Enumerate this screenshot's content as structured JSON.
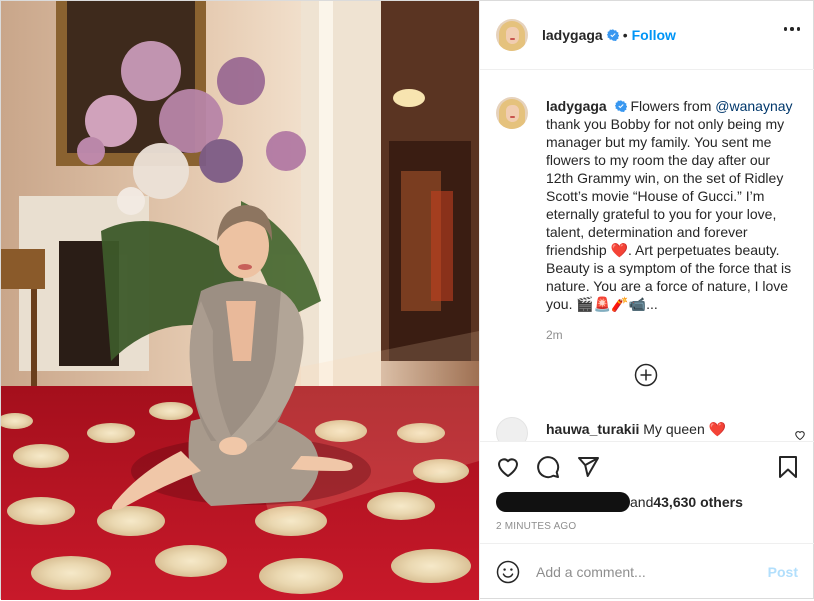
{
  "post": {
    "author": "ladygaga",
    "follow_label": "Follow",
    "separator": "•",
    "photo_alt": "Lady Gaga sitting on red carpet",
    "caption": {
      "username": "ladygaga",
      "text_before_mention": " Flowers from ",
      "mention": "@wanaynay",
      "text_part1": " thank you Bobby for not only being my manager but my family. You sent me flowers to my room the day after our 12th Grammy win, on the set of Ridley Scott’s movie “House of Gucci.” I’m eternally grateful to you for your love, talent, determination and forever friendship ",
      "heart": "❤️",
      "text_part2": ". Art perpetuates beauty. Beauty is a symptom of the force that is nature. You are a force of nature, I love you. 🎬🚨🧨📹...",
      "time": "2m"
    },
    "reply": {
      "username": "hauwa_turakii",
      "text": " My queen ",
      "heart": "❤️"
    },
    "likes": {
      "text": "and ",
      "count": "43,630 others"
    },
    "posted_time": "2 MINUTES AGO",
    "comment_placeholder": "Add a comment...",
    "post_label": "Post"
  },
  "icons": {
    "more": "more-options-icon",
    "verified": "verified-badge-icon",
    "load_more": "plus-circle-icon",
    "like": "heart-icon",
    "comment": "comment-icon",
    "share": "share-icon",
    "save": "bookmark-icon",
    "emoji": "smiley-icon"
  },
  "colors": {
    "accent": "#0095f6",
    "verified": "#3897f0",
    "mention": "#00376b",
    "muted": "#8e8e8e",
    "post_disabled": "#b2dffc",
    "heart": "#ed1c24"
  }
}
